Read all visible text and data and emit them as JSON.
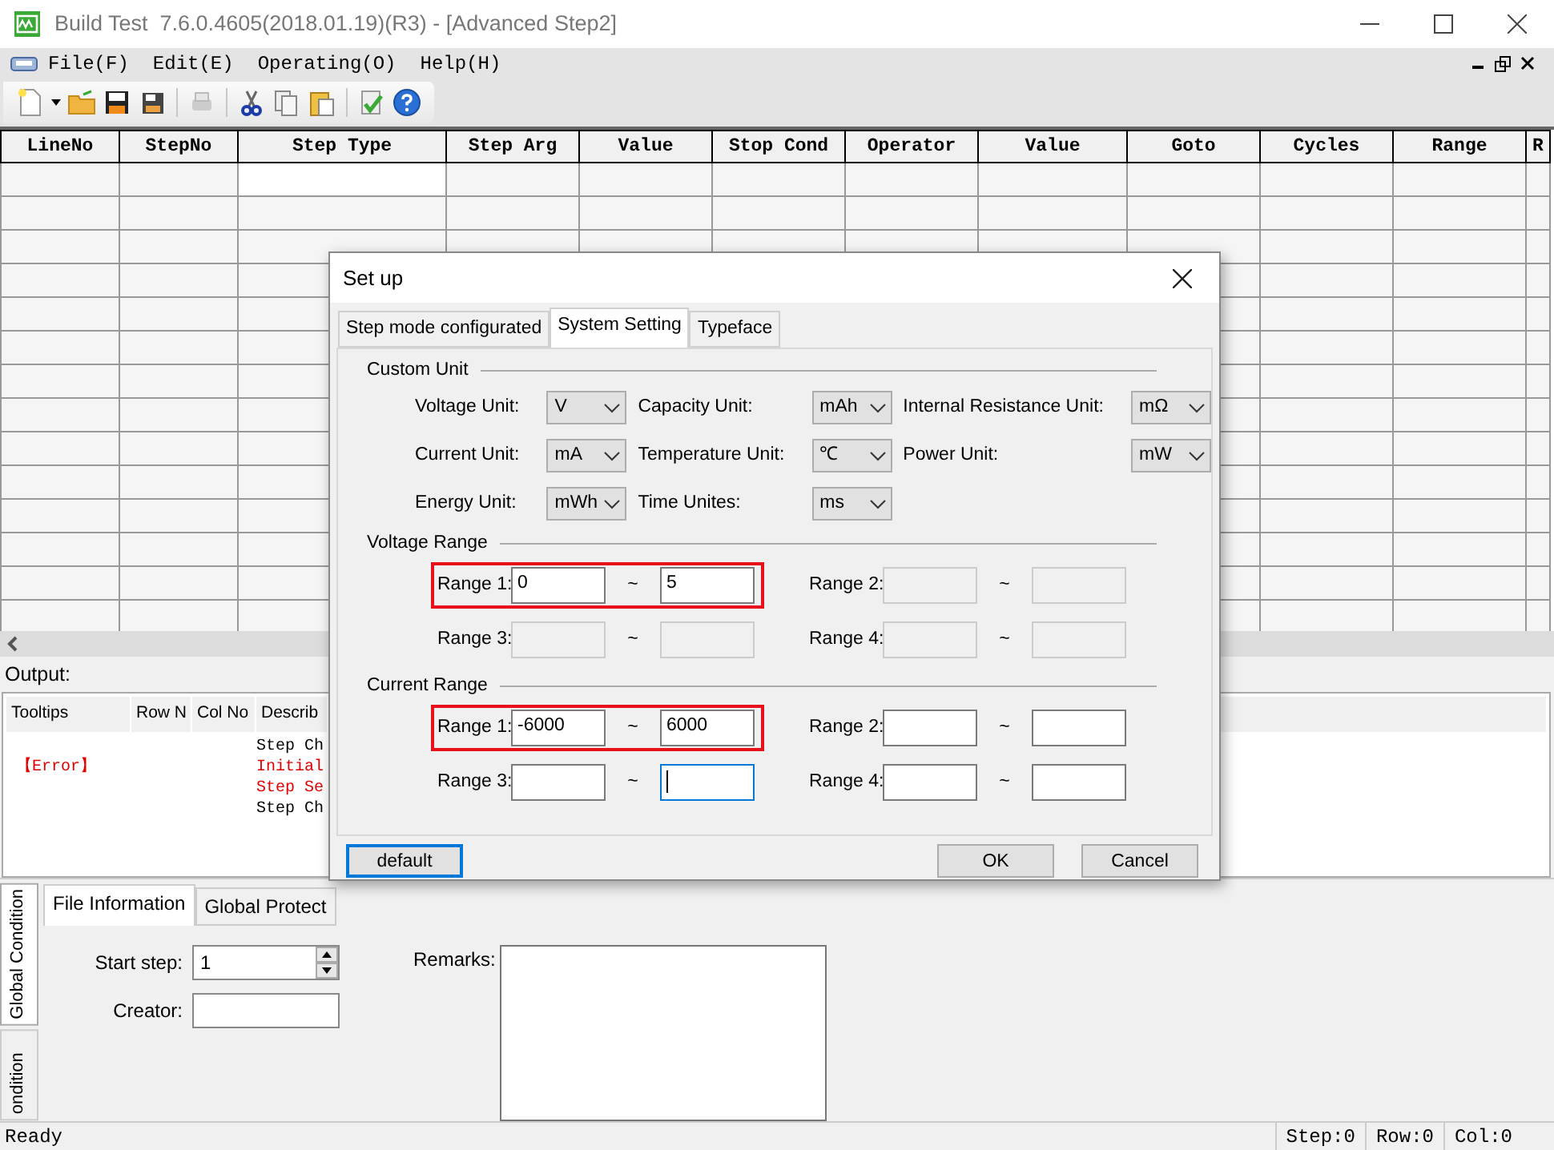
{
  "window": {
    "title": "Build Test  7.6.0.4605(2018.01.19)(R3) - [Advanced Step2]"
  },
  "menu": [
    "File(F)",
    "Edit(E)",
    "Operating(O)",
    "Help(H)"
  ],
  "grid": {
    "columns": [
      "LineNo",
      "StepNo",
      "Step Type",
      "Step Arg",
      "Value",
      "Stop Cond",
      "Operator",
      "Value",
      "Goto",
      "Cycles",
      "Range",
      "R"
    ]
  },
  "output": {
    "label": "Output:",
    "columns": [
      "Tooltips",
      "Row N",
      "Col No",
      "Describ"
    ],
    "rows": [
      {
        "describe": "Step Ch",
        "error": false
      },
      {
        "tooltip": "【Error】",
        "describe": "Initial",
        "error": true
      },
      {
        "describe": "Step Se",
        "error": true
      },
      {
        "describe": "Step Ch",
        "error": false
      }
    ]
  },
  "side_tabs": [
    {
      "label": "Global Condition",
      "selected": true
    },
    {
      "label": "ondition",
      "selected": false
    }
  ],
  "tabs": [
    {
      "label": "File Information",
      "selected": true
    },
    {
      "label": "Global Protect",
      "selected": false
    }
  ],
  "file_info": {
    "start_step": {
      "label": "Start step:",
      "value": "1"
    },
    "creator": {
      "label": "Creator:"
    },
    "remarks": {
      "label": "Remarks:"
    }
  },
  "status_bar": {
    "message": "Ready",
    "cells": [
      "Step:0",
      "Row:0",
      "Col:0"
    ]
  },
  "dialog": {
    "title": "Set up",
    "tabs": [
      {
        "label": "Step mode configurated",
        "selected": false
      },
      {
        "label": "System Setting",
        "selected": true
      },
      {
        "label": "Typeface",
        "selected": false
      }
    ],
    "custom_unit": {
      "title": "Custom Unit",
      "fields": [
        {
          "label": "Voltage Unit:",
          "value": "V"
        },
        {
          "label": "Capacity Unit:",
          "value": "mAh"
        },
        {
          "label": "Internal Resistance Unit:",
          "value": "mΩ"
        },
        {
          "label": "Current Unit:",
          "value": "mA"
        },
        {
          "label": "Temperature Unit:",
          "value": "℃"
        },
        {
          "label": "Power Unit:",
          "value": "mW"
        },
        {
          "label": "Energy Unit:",
          "value": "mWh"
        },
        {
          "label": "Time Unites:",
          "value": "ms"
        }
      ]
    },
    "range_groups": [
      {
        "title": "Voltage Range",
        "ranges": [
          {
            "label": "Range 1:",
            "from": "0",
            "separator": "~",
            "to": "5",
            "disabled": false,
            "highlighted": true,
            "focused": false
          },
          {
            "label": "Range 2:",
            "separator": "~",
            "disabled": true,
            "highlighted": false,
            "focused": false
          },
          {
            "label": "Range 3:",
            "separator": "~",
            "disabled": true,
            "highlighted": false,
            "focused": false
          },
          {
            "label": "Range 4:",
            "separator": "~",
            "disabled": true,
            "highlighted": false,
            "focused": false
          }
        ]
      },
      {
        "title": "Current Range",
        "ranges": [
          {
            "label": "Range 1:",
            "from": "-6000",
            "separator": "~",
            "to": "6000",
            "disabled": false,
            "highlighted": true,
            "focused": false
          },
          {
            "label": "Range 2:",
            "separator": "~",
            "disabled": false,
            "highlighted": false,
            "focused": false
          },
          {
            "label": "Range 3:",
            "separator": "~",
            "disabled": false,
            "highlighted": false,
            "focused": true
          },
          {
            "label": "Range 4:",
            "separator": "~",
            "disabled": false,
            "highlighted": false,
            "focused": false
          }
        ]
      }
    ],
    "buttons": [
      {
        "label": "default",
        "focused": true
      },
      {
        "label": "OK",
        "focused": false
      },
      {
        "label": "Cancel",
        "focused": false
      }
    ]
  }
}
